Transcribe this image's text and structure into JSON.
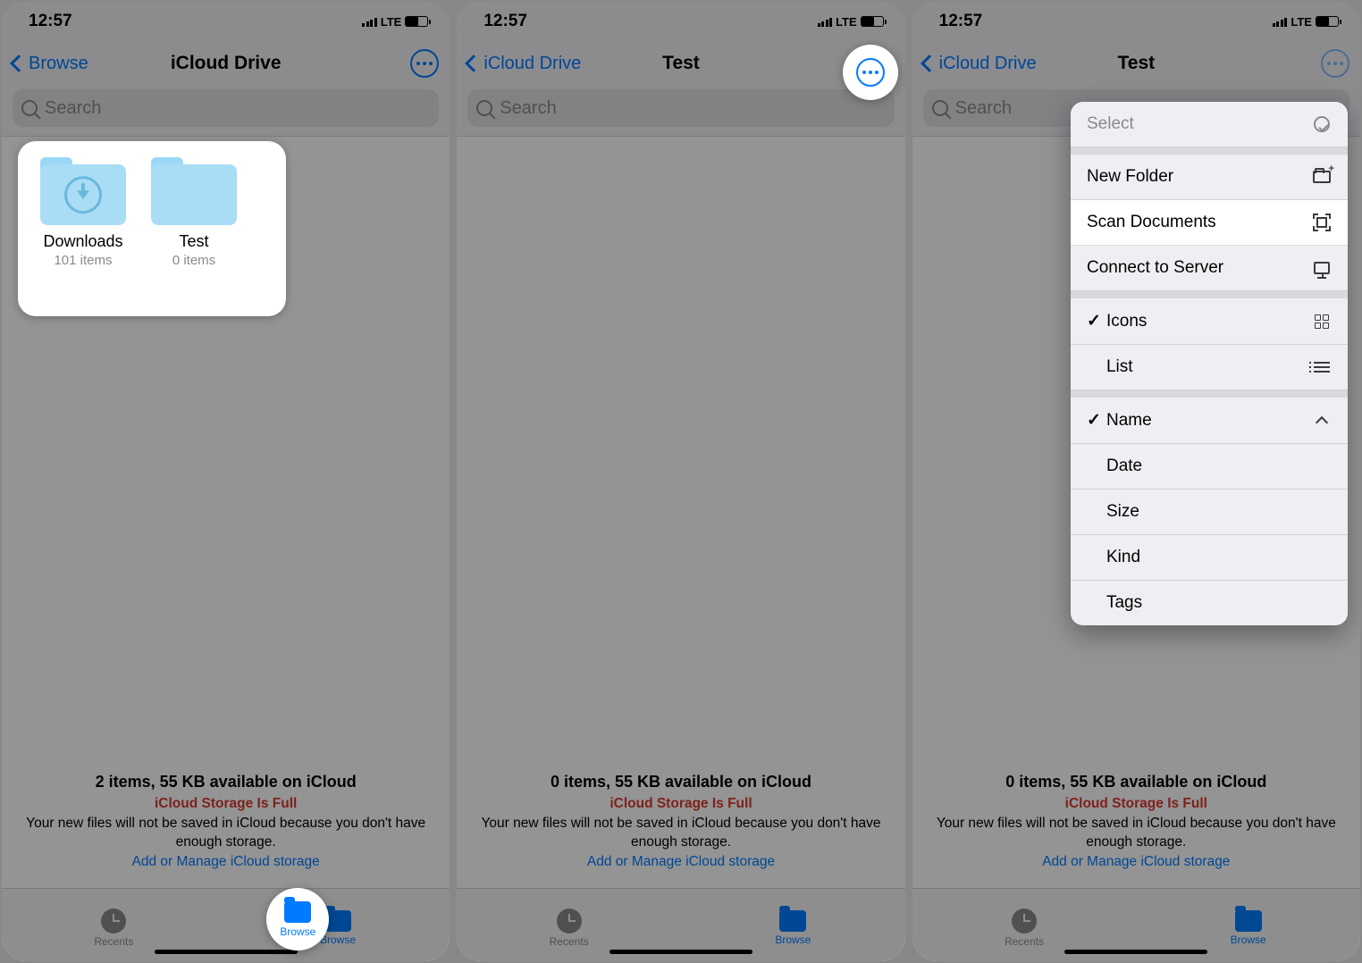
{
  "status": {
    "time": "12:57",
    "network": "LTE"
  },
  "screens": [
    {
      "nav": {
        "back": "Browse",
        "title": "iCloud Drive"
      },
      "search_placeholder": "Search",
      "folders": [
        {
          "name": "Downloads",
          "sub": "101 items",
          "has_download_badge": true
        },
        {
          "name": "Test",
          "sub": "0 items",
          "has_download_badge": false
        }
      ],
      "storage": {
        "line1": "2 items, 55 KB available on iCloud",
        "line2": "iCloud Storage Is Full",
        "line3": "Your new files will not be saved in iCloud because you don't have enough storage.",
        "line4": "Add or Manage iCloud storage"
      }
    },
    {
      "nav": {
        "back": "iCloud Drive",
        "title": "Test"
      },
      "search_placeholder": "Search",
      "storage": {
        "line1": "0 items, 55 KB available on iCloud",
        "line2": "iCloud Storage Is Full",
        "line3": "Your new files will not be saved in iCloud because you don't have enough storage.",
        "line4": "Add or Manage iCloud storage"
      }
    },
    {
      "nav": {
        "back": "iCloud Drive",
        "title": "Test"
      },
      "search_placeholder": "Search",
      "storage": {
        "line1": "0 items, 55 KB available on iCloud",
        "line2": "iCloud Storage Is Full",
        "line3": "Your new files will not be saved in iCloud because you don't have enough storage.",
        "line4": "Add or Manage iCloud storage"
      },
      "menu": {
        "select": "Select",
        "new_folder": "New Folder",
        "scan": "Scan Documents",
        "connect": "Connect to Server",
        "icons": "Icons",
        "list": "List",
        "name": "Name",
        "date": "Date",
        "size": "Size",
        "kind": "Kind",
        "tags": "Tags"
      }
    }
  ],
  "tabs": {
    "recents": "Recents",
    "browse": "Browse"
  }
}
